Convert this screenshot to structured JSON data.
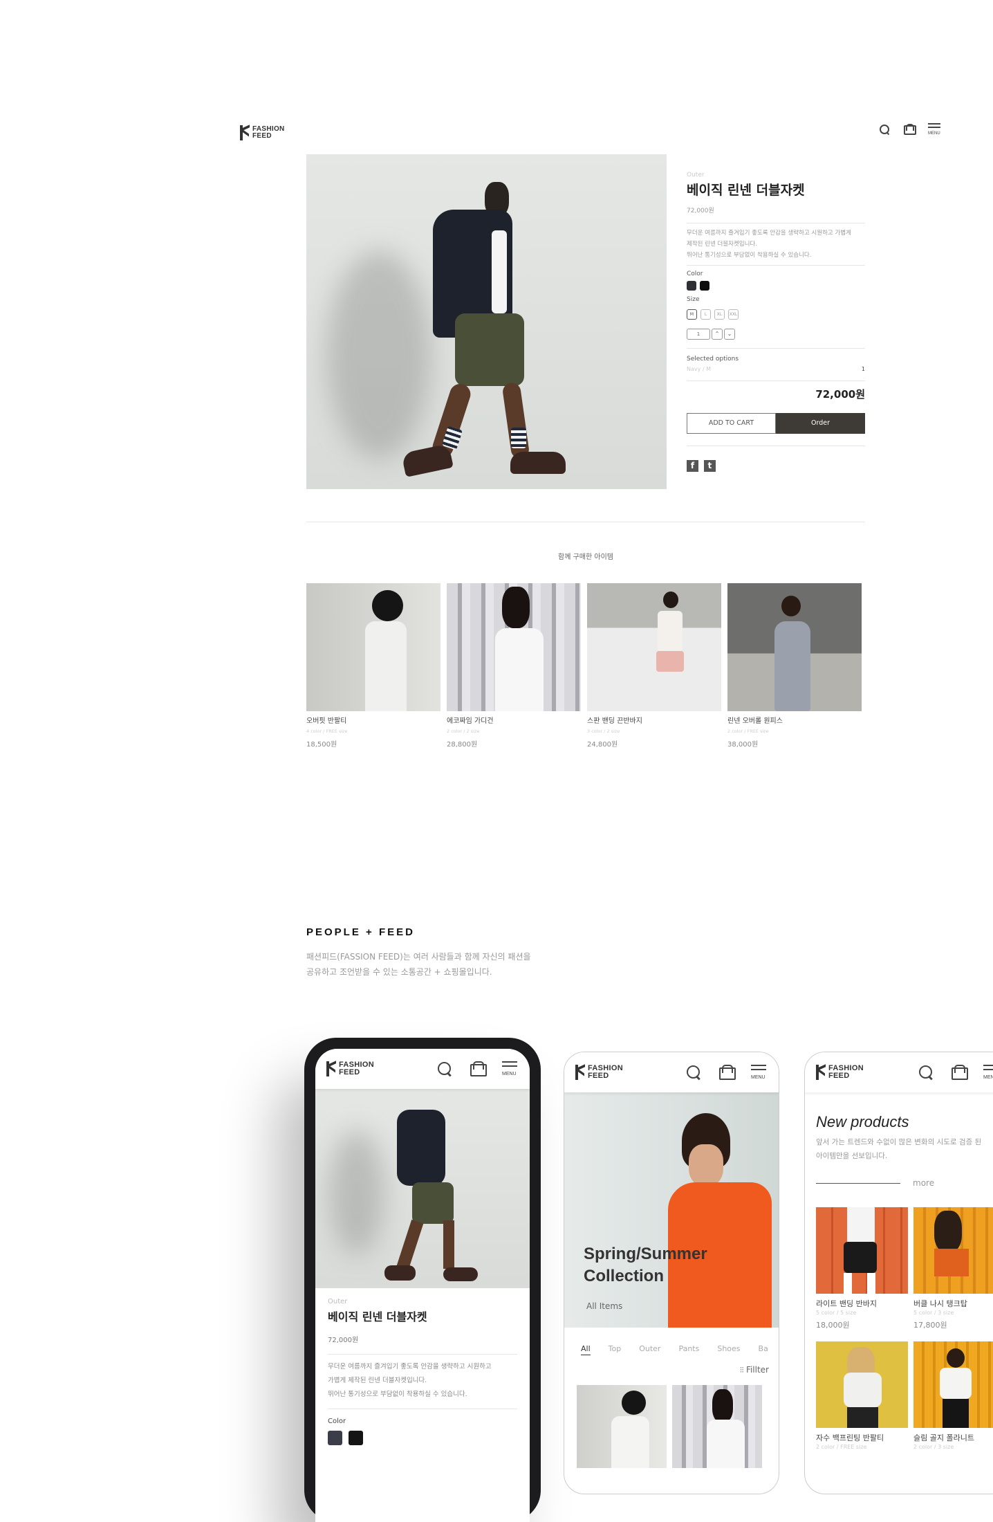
{
  "brand": {
    "line1": "FASHION",
    "line2": "FEED"
  },
  "header": {
    "icons": [
      "search-icon",
      "bag-icon",
      "menu-icon"
    ],
    "menu_label": "MENU"
  },
  "product": {
    "category": "Outer",
    "title": "베이직 린넨 더블자켓",
    "price": "72,000원",
    "description": [
      "무더운 여름까지 즐겨입기 좋도록 안감을 생략하고 시원하고 가볍게",
      "제작된 린넨 더블자켓입니다.",
      "뛰어난 통기성으로 부담없이 착용하실 수 있습니다."
    ],
    "color_label": "Color",
    "colors": [
      "#2e3036",
      "#0d0d0d"
    ],
    "size_label": "Size",
    "sizes": [
      "M",
      "L",
      "XL",
      "XXL"
    ],
    "selected_size": "M",
    "quantity": "1",
    "qty_up": "⌃",
    "qty_down": "⌄",
    "selected_options_label": "Selected options",
    "selected_option": "Navy  /  M",
    "selected_qty": "1",
    "total": "72,000원",
    "add_to_cart": "ADD TO CART",
    "order": "Order",
    "social": [
      {
        "name": "facebook",
        "glyph": "f"
      },
      {
        "name": "twitter",
        "glyph": "t"
      }
    ],
    "accent_color": "#3e3a35"
  },
  "related": {
    "title": "함께 구매한 아이템",
    "items": [
      {
        "name": "오버핏 반팔티",
        "meta": "4 color  / FREE size",
        "price": "18,500원"
      },
      {
        "name": "에코짜임 가디건",
        "meta": "2 color  / 2 size",
        "price": "28,800원"
      },
      {
        "name": "스판 밴딩 끈반바지",
        "meta": "3 color  / 2 size",
        "price": "24,800원"
      },
      {
        "name": "린넨 오버롤 원피스",
        "meta": "2 color  / FREE size",
        "price": "38,000원"
      }
    ]
  },
  "people_feed": {
    "title": "PEOPLE + FEED",
    "desc_line1": "패션피드(FASSION FEED)는 여러 사람들과 함께 자신의 패션을",
    "desc_line2": "공유하고 조언받을 수 있는 소통공간 + 쇼핑몰입니다."
  },
  "mobile1": {
    "category": "Outer",
    "title": "베이직 린넨 더블자켓",
    "price": "72,000원",
    "description": [
      "무더운 여름까지 즐겨입기 좋도록 안감을 생략하고 시원하고",
      "가볍게 제작된 린넨 더블자켓입니다.",
      "뛰어난 통기성으로 부담없이 착용하실 수 있습니다."
    ],
    "color_label": "Color",
    "colors": [
      "#3b3e48",
      "#141414"
    ]
  },
  "mobile2": {
    "hero_title_1": "Spring/Summer",
    "hero_title_2": "Collection",
    "hero_link": "All Items",
    "tabs": [
      "All",
      "Top",
      "Outer",
      "Pants",
      "Shoes",
      "Ba"
    ],
    "active_tab": "All",
    "filter_label": "Fillter"
  },
  "mobile3": {
    "title": "New products",
    "desc_line1": "앞서 가는 트렌드와 수없이 많은 변화의 시도로 검증 된",
    "desc_line2": "아이템만을 선보입니다.",
    "more": "more",
    "items": [
      {
        "name": "라이트 밴딩 반바지",
        "meta": "5 color  / 5 size",
        "price": "18,000원"
      },
      {
        "name": "버클 나시 탱크탑",
        "meta": "5 color  / 3 size",
        "price": "17,800원"
      },
      {
        "name": "자수 백프린팅 반팔티",
        "meta": "2 color  / FREE size",
        "price": ""
      },
      {
        "name": "슬림 골지 폴라니트",
        "meta": "2 color  / 3 size",
        "price": ""
      }
    ]
  }
}
